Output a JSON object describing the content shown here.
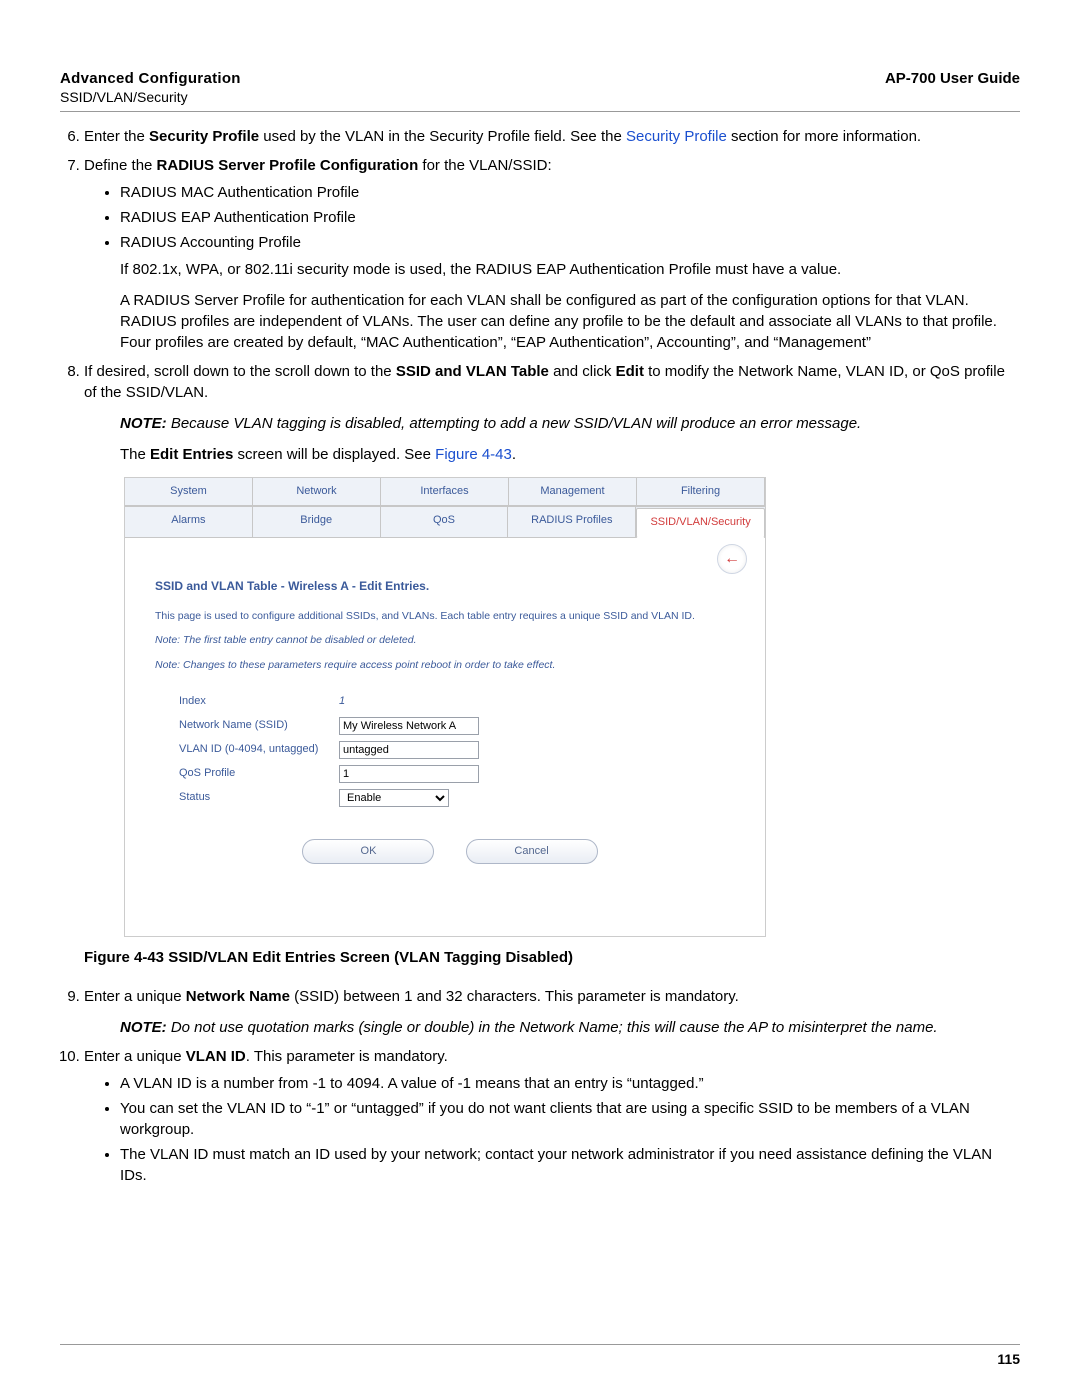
{
  "header": {
    "left_title": "Advanced Configuration",
    "right_title": "AP-700 User Guide",
    "sub": "SSID/VLAN/Security"
  },
  "step6": {
    "prefix": "Enter the ",
    "bold1": "Security Profile",
    "mid": " used by the VLAN in the Security Profile field. See the ",
    "link": "Security Profile",
    "suffix": " section for more information."
  },
  "step7": {
    "prefix": "Define the ",
    "bold1": "RADIUS Server Profile Configuration",
    "suffix": " for the VLAN/SSID:",
    "bullets": {
      "b1": "RADIUS MAC Authentication Profile",
      "b2": "RADIUS EAP Authentication Profile",
      "b3": "RADIUS Accounting Profile"
    },
    "para1": "If 802.1x, WPA, or 802.11i security mode is used, the RADIUS EAP Authentication Profile must have a value.",
    "para2": "A RADIUS Server Profile for authentication for each VLAN shall be configured as part of the configuration options for that VLAN. RADIUS profiles are independent of VLANs. The user can define any profile to be the default and associate all VLANs to that profile. Four profiles are created by default, “MAC Authentication”, “EAP Authentication”, Accounting”, and “Management”"
  },
  "step8": {
    "p1_a": "If desired, scroll down to the scroll down to the ",
    "p1_b": "SSID and VLAN Table",
    "p1_c": " and click ",
    "p1_d": "Edit",
    "p1_e": " to modify the Network Name, VLAN ID, or QoS profile of the SSID/VLAN.",
    "note_label": "NOTE:",
    "note_body": " Because VLAN tagging is disabled, attempting to add a new SSID/VLAN will produce an error message.",
    "p2_a": "The ",
    "p2_b": "Edit Entries",
    "p2_c": " screen will be displayed. See ",
    "p2_link": "Figure 4-43",
    "p2_d": "."
  },
  "screenshot": {
    "tabs_row1": {
      "t1": "System",
      "t2": "Network",
      "t3": "Interfaces",
      "t4": "Management",
      "t5": "Filtering"
    },
    "tabs_row2": {
      "t1": "Alarms",
      "t2": "Bridge",
      "t3": "QoS",
      "t4": "RADIUS Profiles",
      "t5": "SSID/VLAN/Security"
    },
    "back_arrow": "←",
    "title": "SSID and VLAN Table - Wireless A - Edit Entries.",
    "desc": "This page is used to configure additional SSIDs, and VLANs. Each table entry requires a unique SSID and VLAN ID.",
    "note1": "Note: The first table entry cannot be disabled or deleted.",
    "note2": "Note: Changes to these parameters require access point reboot in order to take effect.",
    "form": {
      "index_label": "Index",
      "index_value": "1",
      "ssid_label": "Network Name (SSID)",
      "ssid_value": "My Wireless Network A",
      "vlan_label": "VLAN ID (0-4094, untagged)",
      "vlan_value": "untagged",
      "qos_label": "QoS Profile",
      "qos_value": "1",
      "status_label": "Status",
      "status_value": "Enable"
    },
    "buttons": {
      "ok": "OK",
      "cancel": "Cancel"
    }
  },
  "caption": "Figure 4-43 SSID/VLAN Edit Entries Screen (VLAN Tagging Disabled)",
  "step9": {
    "a": "Enter a unique ",
    "b": "Network Name",
    "c": " (SSID) between 1 and 32 characters. This parameter is mandatory.",
    "note_label": "NOTE:",
    "note_body": " Do not use quotation marks (single or double) in the Network Name; this will cause the AP to misinterpret the name."
  },
  "step10": {
    "a": "Enter a unique ",
    "b": "VLAN ID",
    "c": ". This parameter is mandatory.",
    "bul1": "A VLAN ID is a number from -1 to 4094. A value of -1 means that an entry is “untagged.”",
    "bul2": "You can set the VLAN ID to “-1” or “untagged” if you do not want clients that are using a specific SSID to be members of a VLAN workgroup.",
    "bul3": "The VLAN ID must match an ID used by your network; contact your network administrator if you need assistance defining the VLAN IDs."
  },
  "page_number": "115"
}
